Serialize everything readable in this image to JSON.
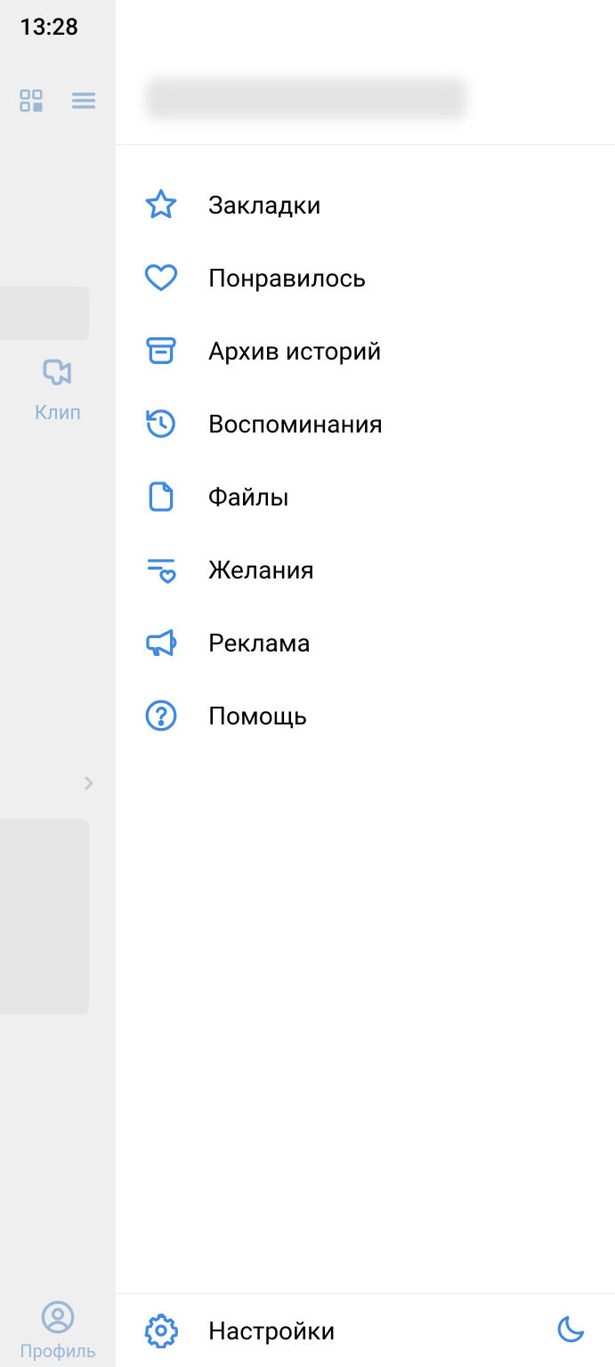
{
  "status": {
    "time": "13:28"
  },
  "bg": {
    "klip_label": "Клип",
    "profile_label": "Профиль"
  },
  "drawer": {
    "title": "",
    "menu": [
      {
        "id": "bookmarks",
        "label": "Закладки"
      },
      {
        "id": "liked",
        "label": "Понравилось"
      },
      {
        "id": "stories-archive",
        "label": "Архив историй"
      },
      {
        "id": "memories",
        "label": "Воспоминания"
      },
      {
        "id": "files",
        "label": "Файлы"
      },
      {
        "id": "wishlist",
        "label": "Желания"
      },
      {
        "id": "ads",
        "label": "Реклама"
      },
      {
        "id": "help",
        "label": "Помощь"
      }
    ],
    "footer": {
      "settings_label": "Настройки"
    }
  },
  "colors": {
    "accent": "#3f8ae0"
  }
}
